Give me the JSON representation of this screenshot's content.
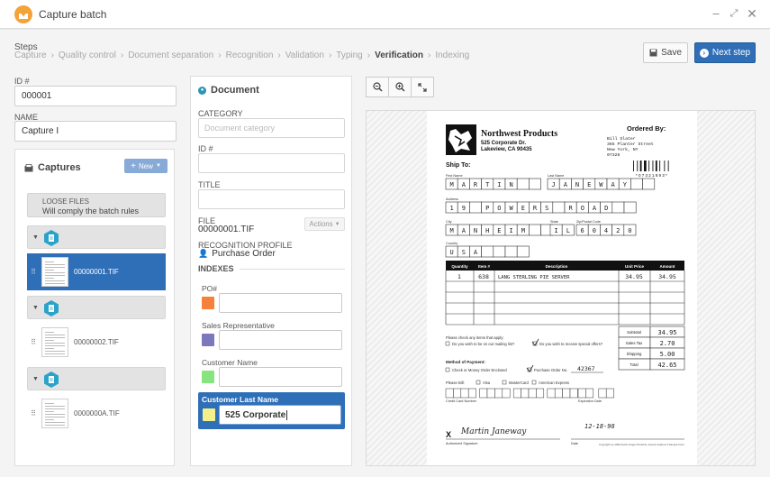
{
  "window": {
    "title": "Capture batch"
  },
  "steps": {
    "label": "Steps",
    "items": [
      "Capture",
      "Quality control",
      "Document separation",
      "Recognition",
      "Validation",
      "Typing",
      "Verification",
      "Indexing"
    ],
    "active_index": 6
  },
  "toolbar": {
    "save_label": "Save",
    "next_label": "Next step"
  },
  "batch": {
    "id_label": "ID #",
    "id_value": "000001",
    "name_label": "NAME",
    "name_value": "Capture I"
  },
  "captures": {
    "title": "Captures",
    "new_label": "New",
    "loose_files": {
      "title": "LOOSE FILES",
      "subtitle": "Will comply the batch rules"
    },
    "files": [
      "00000001.TIF",
      "00000002.TIF",
      "0000000A.TIF"
    ],
    "selected_index": 0
  },
  "document": {
    "title": "Document",
    "category_label": "CATEGORY",
    "category_placeholder": "Document category",
    "id_label": "ID #",
    "title_label": "TITLE",
    "file_label": "FILE",
    "file_value": "00000001.TIF",
    "actions_label": "Actions",
    "profile_label": "RECOGNITION PROFILE",
    "profile_value": "Purchase Order",
    "indexes_label": "INDEXES",
    "indexes": [
      {
        "label": "PO#",
        "color": "#f5813a",
        "value": ""
      },
      {
        "label": "Sales Representative",
        "color": "#7b78bd",
        "value": ""
      },
      {
        "label": "Customer Name",
        "color": "#86e57e",
        "value": ""
      },
      {
        "label": "Customer Last Name",
        "color": "#f3f08b",
        "value": "525 Corporate"
      }
    ]
  },
  "invoice": {
    "company": "Northwest Products",
    "address1": "525 Corporate Dr.",
    "address2": "Lakeview, CA  90435",
    "ordered_by_label": "Ordered By:",
    "ordered_by": [
      "Bill Slater",
      "365 Planter Street",
      "New York, NY",
      "07326"
    ],
    "barcode_text": "* 0 7 3 2 1 8 9 3 *",
    "ship_to_label": "Ship To:",
    "first_name_label": "First Name",
    "first_name": [
      "M",
      "A",
      "R",
      "T",
      "I",
      "N",
      "",
      ""
    ],
    "last_name_label": "Last Name",
    "last_name": [
      "J",
      "A",
      "N",
      "E",
      "W",
      "A",
      "Y",
      "",
      ""
    ],
    "address_label": "Address",
    "address": [
      "1",
      "9",
      "",
      "P",
      "O",
      "W",
      "E",
      "R",
      "S",
      "",
      "R",
      "O",
      "A",
      "D",
      "",
      ""
    ],
    "city_label": "City",
    "city": [
      "M",
      "A",
      "N",
      "H",
      "E",
      "I",
      "M",
      "",
      ""
    ],
    "state_label": "State",
    "state": [
      "I",
      "L"
    ],
    "zip_label": "Zip/Postal Code",
    "zip": [
      "6",
      "0",
      "4",
      "2",
      "0"
    ],
    "country_label": "Country",
    "country": [
      "U",
      "S",
      "A",
      "",
      "",
      "",
      ""
    ],
    "headers": [
      "Quantity",
      "Item #",
      "Description",
      "Unit Price",
      "Amount"
    ],
    "line": {
      "qty": "1",
      "item": "638",
      "desc": "LANG STERLING PIE SERVER",
      "unit": "34.95",
      "amount": "34.95"
    },
    "subtotal_label": "Subtotal",
    "subtotal": "34.95",
    "tax_label": "Sales Tax",
    "tax": "2.70",
    "shipping_label": "Shipping",
    "shipping": "5.00",
    "total_label": "Total",
    "total": "42.65",
    "check_items_label": "Please check any items that apply:",
    "mailing_label": "Do you wish to be on our mailing list?",
    "special_label": "Do you wish to receive special offers?",
    "method_label": "Method of Payment:",
    "check_money_label": "Check or Money Order Enclosed",
    "po_label": "Purchase Order No.",
    "po_value": "42367",
    "please_bill_label": "Please Bill:",
    "visa_label": "Visa",
    "mastercard_label": "MasterCard",
    "amex_label": "American Express",
    "credit_card_label": "Credit Card Number",
    "expiration_label": "Expiration Date",
    "signature_x": "X",
    "signature": "Martin Janeway",
    "signed_date": "12-18-98",
    "authorized_label": "Authorized Signature",
    "date_label": "Date",
    "copyright": "Copyright (c) 1994 Kofax Image Products, Ascent Capture 3 Sample Form"
  }
}
